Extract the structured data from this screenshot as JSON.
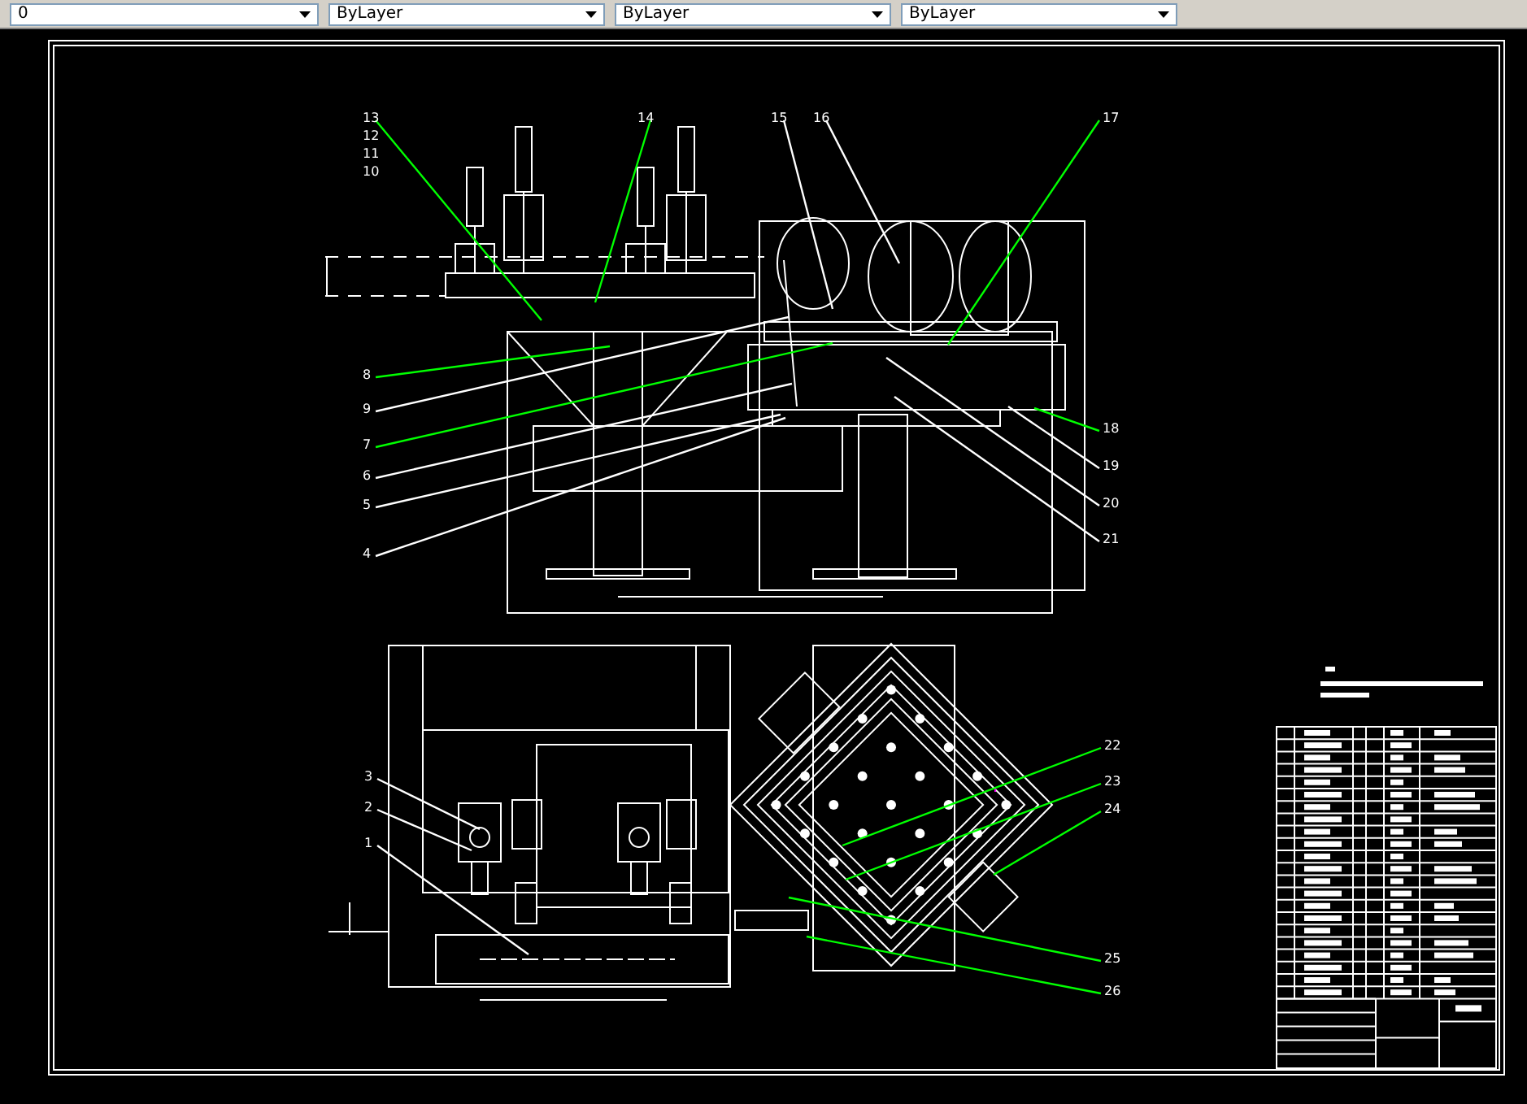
{
  "toolbar": {
    "layer": "0",
    "properties": [
      {
        "label": "ByLayer"
      },
      {
        "label": "ByLayer"
      },
      {
        "label": "ByLayer"
      }
    ]
  },
  "balloons": [
    {
      "label": "13",
      "color": "#00ff00"
    },
    {
      "label": "12"
    },
    {
      "label": "11"
    },
    {
      "label": "10"
    },
    {
      "label": "14",
      "color": "#00ff00"
    },
    {
      "label": "15",
      "color": "#ffffff"
    },
    {
      "label": "16",
      "color": "#ffffff"
    },
    {
      "label": "17",
      "color": "#00ff00"
    },
    {
      "label": "8",
      "color": "#00ff00"
    },
    {
      "label": "9",
      "color": "#ffffff"
    },
    {
      "label": "7",
      "color": "#00ff00"
    },
    {
      "label": "6",
      "color": "#ffffff"
    },
    {
      "label": "5",
      "color": "#ffffff"
    },
    {
      "label": "4",
      "color": "#ffffff"
    },
    {
      "label": "18",
      "color": "#00ff00"
    },
    {
      "label": "19",
      "color": "#ffffff"
    },
    {
      "label": "20",
      "color": "#ffffff"
    },
    {
      "label": "21",
      "color": "#ffffff"
    },
    {
      "label": "3",
      "color": "#ffffff"
    },
    {
      "label": "2",
      "color": "#ffffff"
    },
    {
      "label": "1",
      "color": "#ffffff"
    },
    {
      "label": "22",
      "color": "#00ff00"
    },
    {
      "label": "23",
      "color": "#00ff00"
    },
    {
      "label": "24",
      "color": "#00ff00"
    },
    {
      "label": "25",
      "color": "#00ff00"
    },
    {
      "label": "26",
      "color": "#00ff00"
    }
  ]
}
